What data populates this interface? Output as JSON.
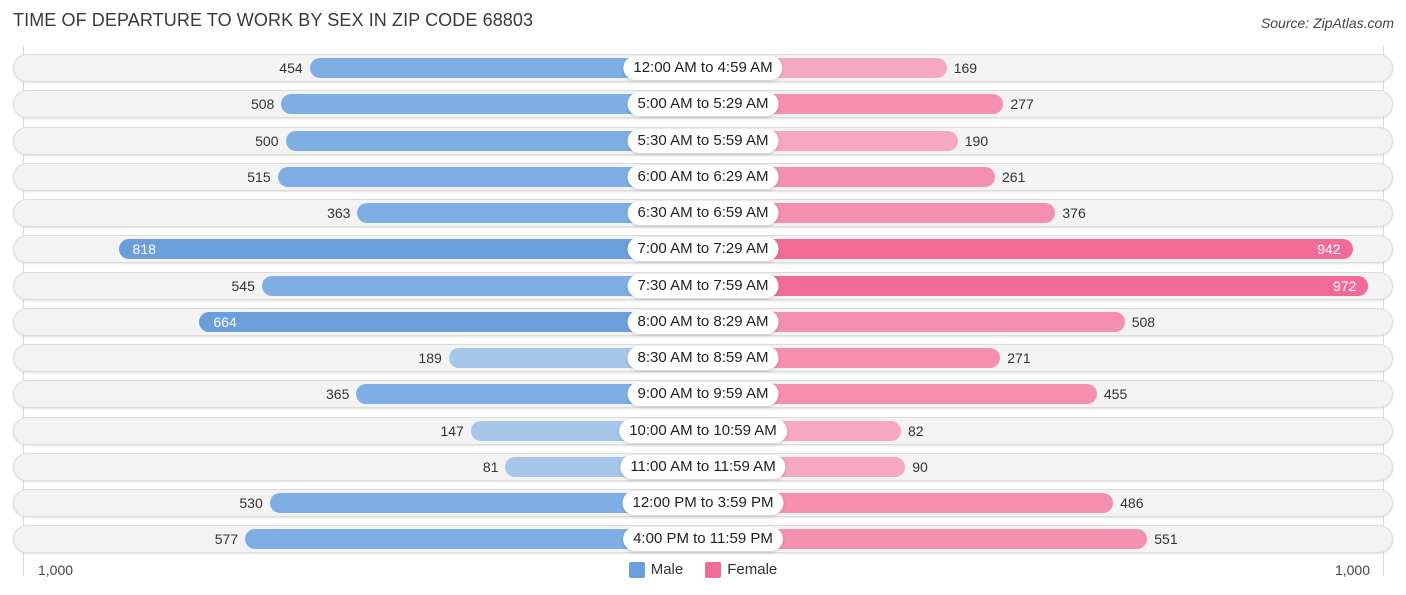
{
  "header": {
    "title": "TIME OF DEPARTURE TO WORK BY SEX IN ZIP CODE 68803",
    "source": "Source: ZipAtlas.com"
  },
  "colors": {
    "male": "#6a9fdc",
    "male_light": "#a6c6ea",
    "female": "#f06b96",
    "female_light": "#f6a8c0"
  },
  "chart_data": {
    "type": "bar",
    "orientation": "horizontal-diverging",
    "title": "TIME OF DEPARTURE TO WORK BY SEX IN ZIP CODE 68803",
    "categories": [
      "12:00 AM to 4:59 AM",
      "5:00 AM to 5:29 AM",
      "5:30 AM to 5:59 AM",
      "6:00 AM to 6:29 AM",
      "6:30 AM to 6:59 AM",
      "7:00 AM to 7:29 AM",
      "7:30 AM to 7:59 AM",
      "8:00 AM to 8:29 AM",
      "8:30 AM to 8:59 AM",
      "9:00 AM to 9:59 AM",
      "10:00 AM to 10:59 AM",
      "11:00 AM to 11:59 AM",
      "12:00 PM to 3:59 PM",
      "4:00 PM to 11:59 PM"
    ],
    "series": [
      {
        "name": "Male",
        "side": "left",
        "values": [
          454,
          508,
          500,
          515,
          363,
          818,
          545,
          664,
          189,
          365,
          147,
          81,
          530,
          577
        ]
      },
      {
        "name": "Female",
        "side": "right",
        "values": [
          169,
          277,
          190,
          261,
          376,
          942,
          972,
          508,
          271,
          455,
          82,
          90,
          486,
          551
        ]
      }
    ],
    "xlim": [
      -1000,
      1000
    ],
    "axis_tick_labels": {
      "left": "1,000",
      "right": "1,000"
    },
    "legend": {
      "position": "bottom-center",
      "entries": [
        "Male",
        "Female"
      ]
    },
    "grid": false
  }
}
